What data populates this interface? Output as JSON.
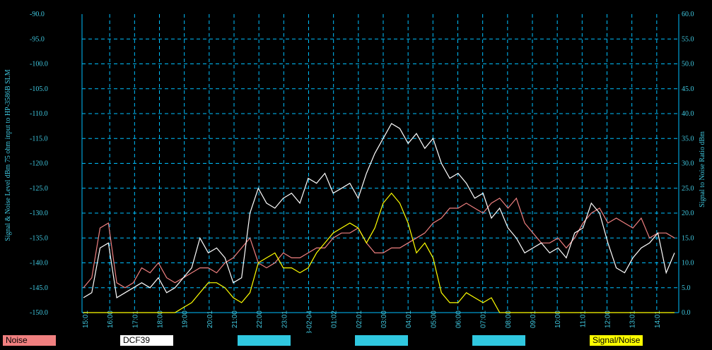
{
  "chart_data": {
    "type": "line",
    "ylabel_left": "Signal & Noise Level  dBm 75 ohm input to HP-3586B SLM",
    "ylabel_right": "Signal to Noise Ratio  dBm",
    "ylim_left": [
      -150,
      -90
    ],
    "ylim_right": [
      0,
      60
    ],
    "left_ticks": [
      "-90.0",
      "-95.0",
      "-100.0",
      "-105.0",
      "-110.0",
      "-115.0",
      "-120.0",
      "-125.0",
      "-130.0",
      "-135.0",
      "-140.0",
      "-145.0",
      "-150.0"
    ],
    "right_ticks": [
      "60.0",
      "55.0",
      "50.0",
      "45.0",
      "40.0",
      "35.0",
      "30.0",
      "25.0",
      "20.0",
      "15.0",
      "10.0",
      "5.0",
      "0.0"
    ],
    "x_ticks": [
      "15:01",
      "16:00",
      "17:01",
      "18:00",
      "19:00",
      "20:01",
      "21:00",
      "22:00",
      "23:01",
      "03-02-04",
      "01:02",
      "02:01",
      "03:00",
      "04:01",
      "05:00",
      "06:00",
      "07:01",
      "08:00",
      "09:01",
      "10:00",
      "11:01",
      "12:00",
      "13:01",
      "14:01"
    ],
    "grid": true,
    "series": [
      {
        "name": "Noise",
        "color": "#f08080",
        "axis": "left",
        "values": [
          -145,
          -143,
          -133,
          -132,
          -144,
          -145,
          -144,
          -141,
          -142,
          -140,
          -143,
          -144,
          -143,
          -142,
          -141,
          -141,
          -142,
          -140,
          -139,
          -137,
          -135,
          -140,
          -141,
          -140,
          -138,
          -139,
          -139,
          -138,
          -137,
          -137,
          -135,
          -134,
          -134,
          -133,
          -136,
          -138,
          -138,
          -137,
          -137,
          -136,
          -135,
          -134,
          -132,
          -131,
          -129,
          -129,
          -128,
          -129,
          -130,
          -128,
          -127,
          -129,
          -127,
          -132,
          -134,
          -136,
          -136,
          -135,
          -137,
          -135,
          -132,
          -130,
          -129,
          -132,
          -131,
          -132,
          -133,
          -131,
          -135,
          -134,
          -134,
          -135
        ]
      },
      {
        "name": "DCF39",
        "color": "#ffffff",
        "axis": "left",
        "values": [
          -147,
          -146,
          -137,
          -136,
          -147,
          -146,
          -145,
          -144,
          -145,
          -143,
          -146,
          -145,
          -143,
          -141,
          -135,
          -138,
          -137,
          -139,
          -144,
          -143,
          -130,
          -125,
          -128,
          -129,
          -127,
          -126,
          -128,
          -123,
          -124,
          -122,
          -126,
          -125,
          -124,
          -127,
          -122,
          -118,
          -115,
          -112,
          -113,
          -116,
          -114,
          -117,
          -115,
          -120,
          -123,
          -122,
          -124,
          -127,
          -126,
          -131,
          -129,
          -133,
          -135,
          -138,
          -137,
          -136,
          -138,
          -137,
          -139,
          -134,
          -133,
          -128,
          -130,
          -136,
          -141,
          -142,
          -139,
          -137,
          -136,
          -134,
          -142,
          -138
        ]
      },
      {
        "name": "Signal/Noise",
        "color": "#ffff00",
        "axis": "right",
        "values": [
          0,
          0,
          0,
          0,
          0,
          0,
          0,
          0,
          0,
          0,
          0,
          0,
          1,
          2,
          4,
          6,
          6,
          5,
          3,
          2,
          4,
          10,
          11,
          12,
          9,
          9,
          8,
          9,
          12,
          14,
          16,
          17,
          18,
          17,
          14,
          17,
          22,
          24,
          22,
          18,
          12,
          14,
          11,
          4,
          2,
          2,
          4,
          3,
          2,
          3,
          0,
          0,
          0,
          0,
          0,
          0,
          0,
          0,
          0,
          0,
          0,
          0,
          0,
          0,
          0,
          0,
          0,
          0,
          0,
          0,
          0,
          0
        ]
      }
    ]
  },
  "legend": {
    "noise": "Noise",
    "dcf39": "DCF39",
    "sn": "Signal/Noise",
    "blank1": "",
    "blank2": "",
    "blank3": ""
  },
  "colors": {
    "grid": "#00bfff",
    "axis_text": "#40c8e0",
    "legend_blank": "#30c8e0"
  }
}
